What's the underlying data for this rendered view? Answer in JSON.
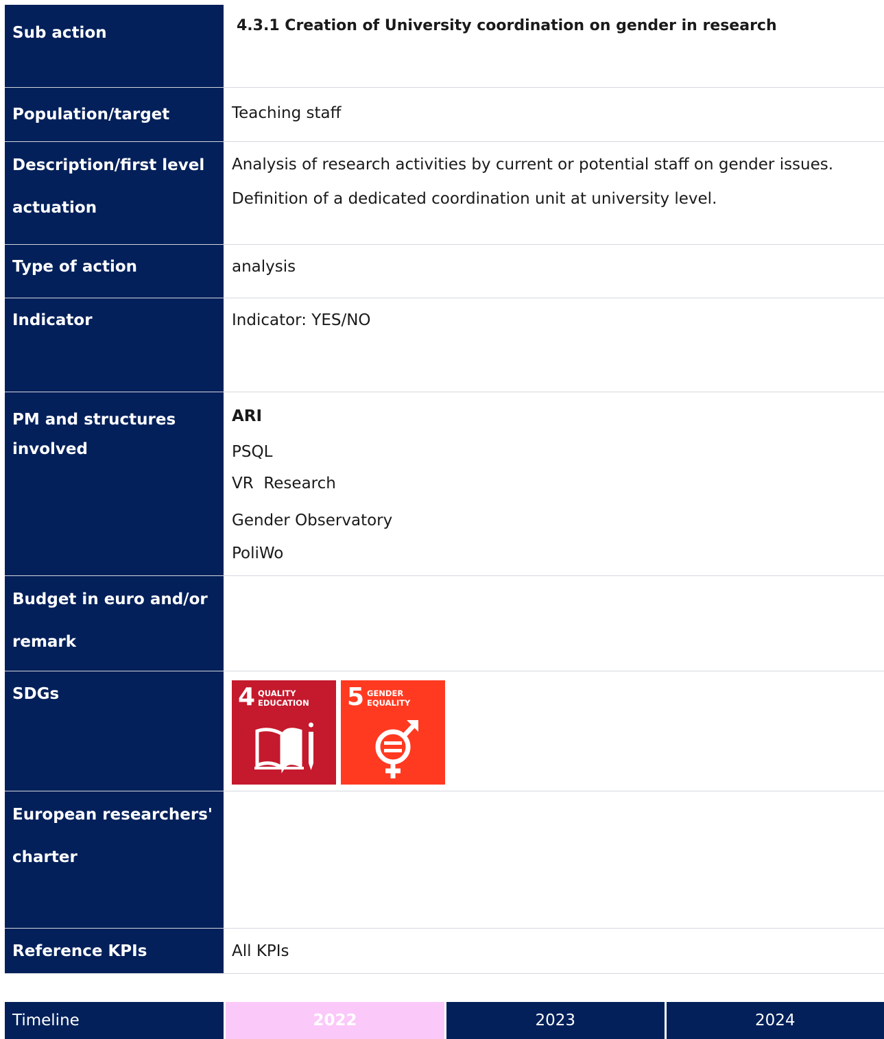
{
  "rows": {
    "sub_action": {
      "label": "Sub action",
      "value": "4.3.1 Creation of University coordination on gender in research"
    },
    "population": {
      "label": "Population/target",
      "value": "Teaching staff"
    },
    "description": {
      "label": "Description/first level actuation",
      "lines": [
        "Analysis of research activities by current or potential staff on gender issues.",
        "Definition of a dedicated coordination unit at university level."
      ]
    },
    "type": {
      "label": "Type of action",
      "value": "analysis"
    },
    "indicator": {
      "label": "Indicator",
      "value": "Indicator: YES/NO"
    },
    "pm": {
      "label": "PM and structures involved",
      "items": [
        "ARI",
        "PSQL",
        "VR  Research",
        "Gender Observatory",
        "PoliWo"
      ]
    },
    "budget": {
      "label": "Budget in euro and/or remark",
      "value": ""
    },
    "sdgs": {
      "label": "SDGs",
      "tiles": [
        {
          "number": "4",
          "title": "QUALITY EDUCATION",
          "color": "#c5192d",
          "icon": "book-pencil-icon"
        },
        {
          "number": "5",
          "title": "GENDER EQUALITY",
          "color": "#ff3a21",
          "icon": "gender-equality-icon"
        }
      ]
    },
    "charter": {
      "label": "European researchers' charter",
      "value": ""
    },
    "kpis": {
      "label": "Reference KPIs",
      "value": "All KPIs"
    }
  },
  "timeline": {
    "label": "Timeline",
    "years": [
      "2022",
      "2023",
      "2024"
    ],
    "highlight_color": "#fbc8fa"
  },
  "colors": {
    "header_bg": "#03205a",
    "border": "#d5d8de"
  }
}
